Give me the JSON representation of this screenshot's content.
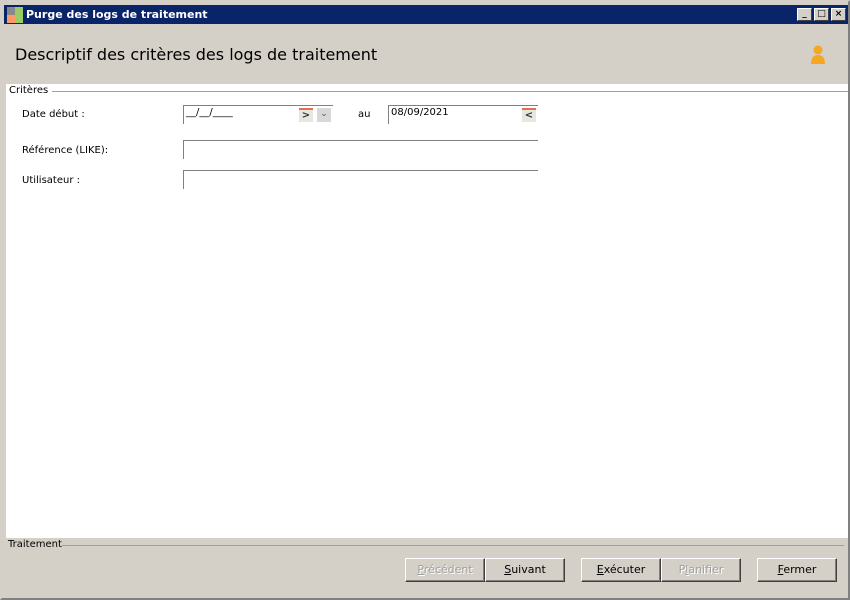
{
  "window": {
    "title": "Purge des logs de traitement",
    "controls": [
      "_",
      "□",
      "×"
    ]
  },
  "header": {
    "title": "Descriptif des critères des logs de traitement"
  },
  "criteria": {
    "legend": "Critères",
    "date_start": {
      "label": "Date début :",
      "value": "__/__/____"
    },
    "to_label": "au",
    "date_end": {
      "value": "08/09/2021"
    },
    "reference": {
      "label": "Référence (LIKE):",
      "value": ""
    },
    "user": {
      "label": "Utilisateur :",
      "value": ""
    }
  },
  "footer": {
    "legend": "Traitement",
    "buttons": [
      {
        "pre": "",
        "key": "P",
        "post": "récédent",
        "enabled": false
      },
      {
        "pre": "",
        "key": "S",
        "post": "uivant",
        "enabled": true
      },
      {
        "pre": "",
        "key": "E",
        "post": "xécuter",
        "enabled": true
      },
      {
        "pre": "P",
        "key": "l",
        "post": "anifier",
        "enabled": false
      },
      {
        "pre": "",
        "key": "F",
        "post": "ermer",
        "enabled": true
      }
    ]
  }
}
